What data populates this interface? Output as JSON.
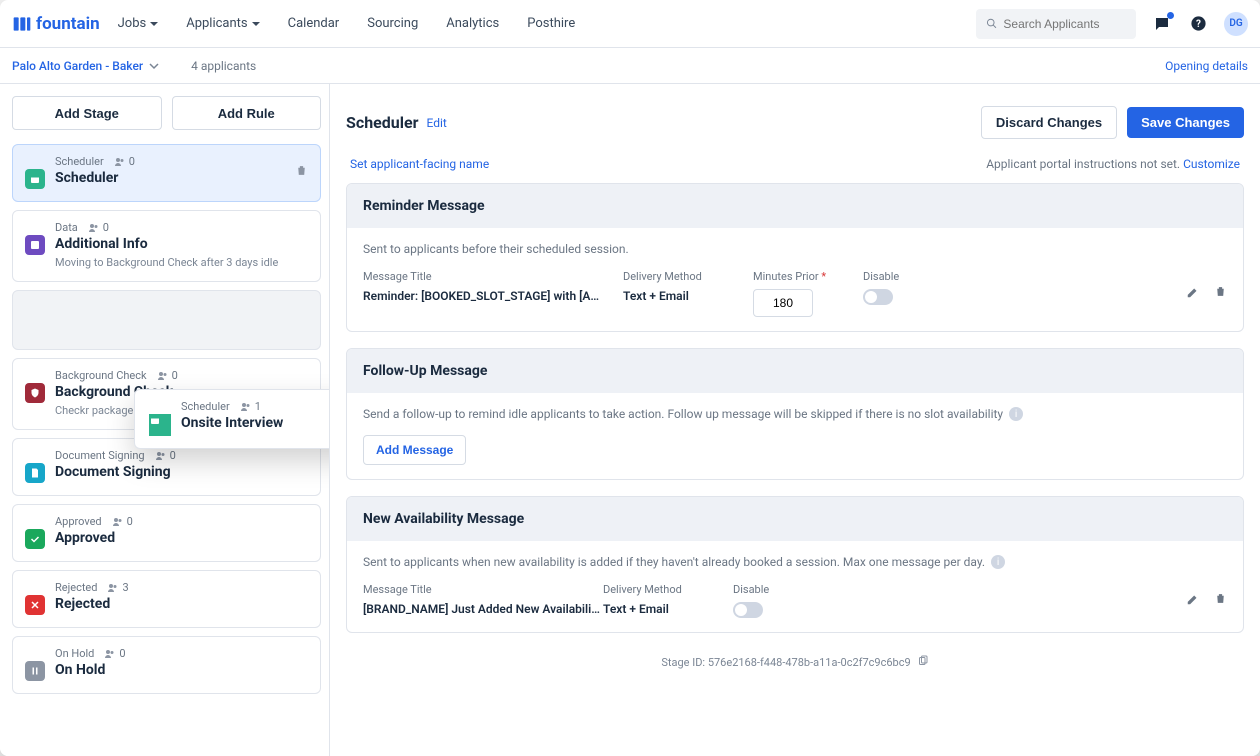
{
  "brand": "fountain",
  "nav": {
    "jobs": "Jobs",
    "applicants": "Applicants",
    "calendar": "Calendar",
    "sourcing": "Sourcing",
    "analytics": "Analytics",
    "posthire": "Posthire"
  },
  "search": {
    "placeholder": "Search Applicants"
  },
  "avatar": "DG",
  "subheader": {
    "breadcrumb": "Palo Alto Garden - Baker",
    "count": "4 applicants",
    "opening": "Opening details"
  },
  "sidebar": {
    "add_stage": "Add Stage",
    "add_rule": "Add Rule",
    "stages": [
      {
        "type": "Scheduler",
        "count": "0",
        "title": "Scheduler"
      },
      {
        "type": "Data",
        "count": "0",
        "title": "Additional Info",
        "sub": "Moving to Background Check after 3 days idle"
      },
      {
        "drag": true,
        "type": "Scheduler",
        "count": "1",
        "title": "Onsite Interview"
      },
      {
        "type": "Background Check",
        "count": "0",
        "title": "Background Check",
        "sub": "Checkr package: driver_pro"
      },
      {
        "type": "Document Signing",
        "count": "0",
        "title": "Document Signing"
      },
      {
        "type": "Approved",
        "count": "0",
        "title": "Approved"
      },
      {
        "type": "Rejected",
        "count": "3",
        "title": "Rejected"
      },
      {
        "type": "On Hold",
        "count": "0",
        "title": "On Hold"
      }
    ]
  },
  "main": {
    "title": "Scheduler",
    "edit": "Edit",
    "discard": "Discard Changes",
    "save": "Save Changes",
    "set_name": "Set applicant-facing name",
    "portal_note": "Applicant portal instructions not set. ",
    "customize": "Customize",
    "reminder": {
      "head": "Reminder Message",
      "desc": "Sent to applicants before their scheduled session.",
      "labels": {
        "title": "Message Title",
        "delivery": "Delivery Method",
        "minutes": "Minutes Prior",
        "disable": "Disable"
      },
      "row": {
        "title": "Reminder: [BOOKED_SLOT_STAGE] with [ACC...",
        "delivery": "Text + Email",
        "minutes": "180"
      }
    },
    "followup": {
      "head": "Follow-Up Message",
      "desc": "Send a follow-up to remind idle applicants to take action. Follow up message will be skipped if there is no slot availability",
      "add": "Add Message"
    },
    "avail": {
      "head": "New Availability Message",
      "desc": "Sent to applicants when new availability is added if they haven't already booked a session. Max one message per day.",
      "labels": {
        "title": "Message Title",
        "delivery": "Delivery Method",
        "disable": "Disable"
      },
      "row": {
        "title": "[BRAND_NAME] Just Added New Availability fo...",
        "delivery": "Text + Email"
      }
    },
    "stage_id": "Stage ID: 576e2168-f448-478b-a11a-0c2f7c9c6bc9"
  }
}
